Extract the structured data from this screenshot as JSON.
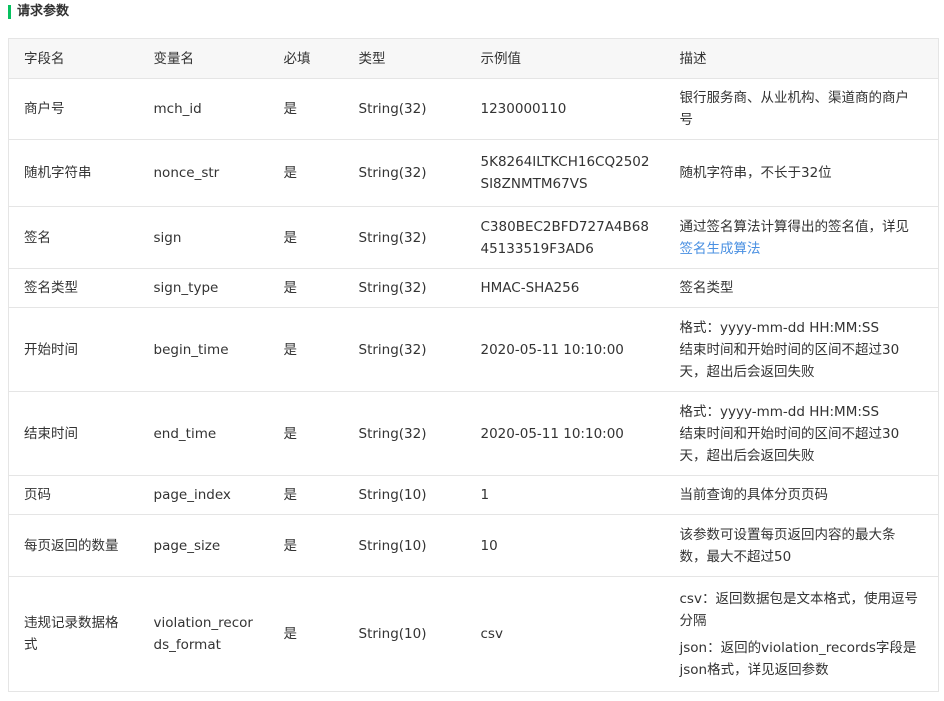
{
  "section": {
    "title": "请求参数",
    "accent_color": "#07c160"
  },
  "table": {
    "headers": [
      "字段名",
      "变量名",
      "必填",
      "类型",
      "示例值",
      "描述"
    ],
    "rows": [
      {
        "field": "商户号",
        "var": "mch_id",
        "required": "是",
        "type": "String(32)",
        "example": "1230000110",
        "desc": "银行服务商、从业机构、渠道商的商户号"
      },
      {
        "field": "随机字符串",
        "var": "nonce_str",
        "required": "是",
        "type": "String(32)",
        "example": "5K8264ILTKCH16CQ2502SI8ZNMTM67VS",
        "desc": "随机字符串，不长于32位"
      },
      {
        "field": "签名",
        "var": "sign",
        "required": "是",
        "type": "String(32)",
        "example": "C380BEC2BFD727A4B6845133519F3AD6",
        "desc_text": "通过签名算法计算得出的签名值，详见",
        "desc_link": "签名生成算法"
      },
      {
        "field": "签名类型",
        "var": "sign_type",
        "required": "是",
        "type": "String(32)",
        "example": "HMAC-SHA256",
        "desc": "签名类型"
      },
      {
        "field": "开始时间",
        "var": "begin_time",
        "required": "是",
        "type": "String(32)",
        "example": "2020-05-11 10:10:00",
        "desc_lines": [
          "格式：yyyy-mm-dd HH:MM:SS",
          "结束时间和开始时间的区间不超过30天，超出后会返回失败"
        ]
      },
      {
        "field": "结束时间",
        "var": "end_time",
        "required": "是",
        "type": "String(32)",
        "example": "2020-05-11 10:10:00",
        "desc_lines": [
          "格式：yyyy-mm-dd HH:MM:SS",
          "结束时间和开始时间的区间不超过30天，超出后会返回失败"
        ]
      },
      {
        "field": "页码",
        "var": "page_index",
        "required": "是",
        "type": "String(10)",
        "example": "1",
        "desc": "当前查询的具体分页页码"
      },
      {
        "field": "每页返回的数量",
        "var": "page_size",
        "required": "是",
        "type": "String(10)",
        "example": "10",
        "desc": "该参数可设置每页返回内容的最大条数，最大不超过50"
      },
      {
        "field": "违规记录数据格式",
        "var": "violation_records_format",
        "required": "是",
        "type": "String(10)",
        "example": "csv",
        "desc_paras": [
          "csv：返回数据包是文本格式，使用逗号分隔",
          "json：返回的violation_records字段是json格式，详见返回参数"
        ]
      }
    ]
  }
}
